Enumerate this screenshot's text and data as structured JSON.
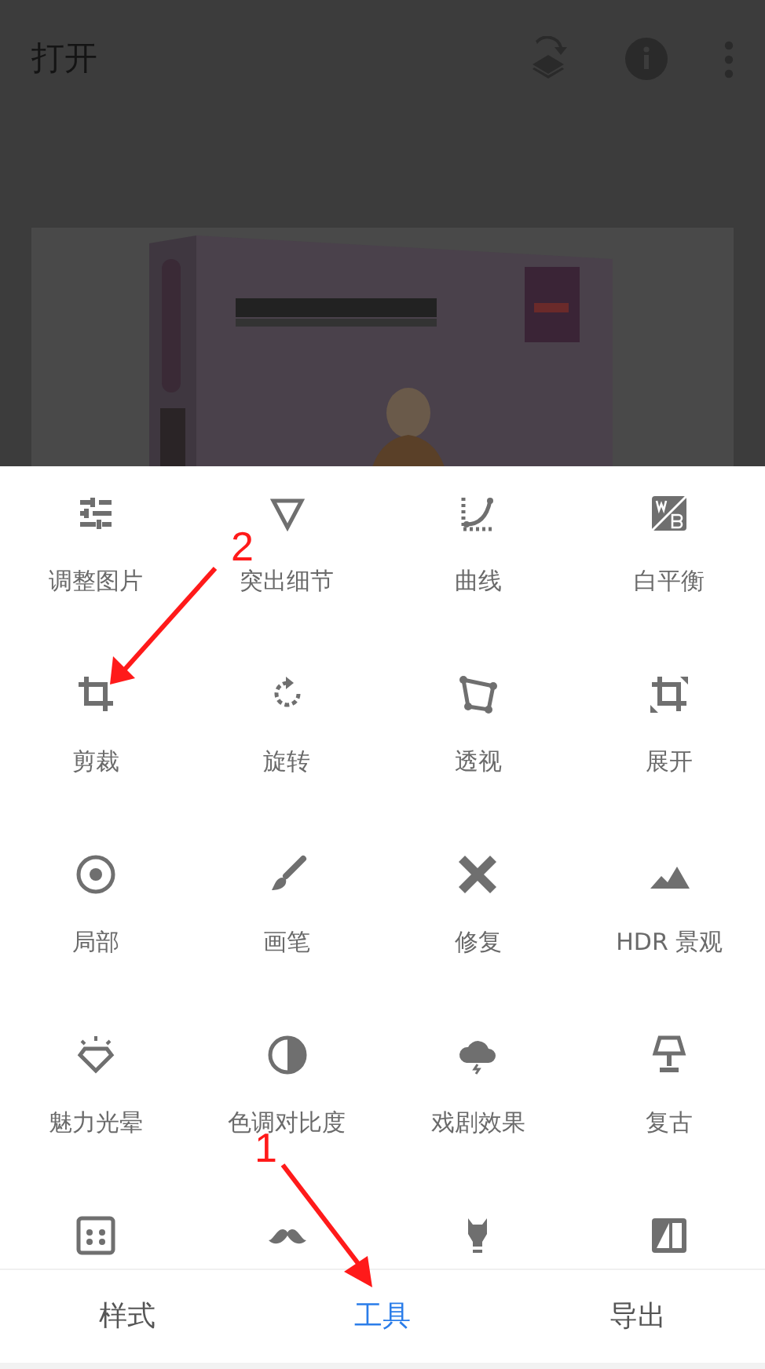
{
  "app_bar": {
    "title": "打开"
  },
  "tools": [
    {
      "kind": "tool",
      "label": "调整图片"
    },
    {
      "kind": "tool",
      "label": "突出细节"
    },
    {
      "kind": "tool",
      "label": "曲线"
    },
    {
      "kind": "tool",
      "label": "白平衡"
    },
    {
      "kind": "tool",
      "label": "剪裁"
    },
    {
      "kind": "tool",
      "label": "旋转"
    },
    {
      "kind": "tool",
      "label": "透视"
    },
    {
      "kind": "tool",
      "label": "展开"
    },
    {
      "kind": "tool",
      "label": "局部"
    },
    {
      "kind": "tool",
      "label": "画笔"
    },
    {
      "kind": "tool",
      "label": "修复"
    },
    {
      "kind": "tool",
      "label": "HDR 景观"
    },
    {
      "kind": "tool",
      "label": "魅力光晕"
    },
    {
      "kind": "tool",
      "label": "色调对比度"
    },
    {
      "kind": "tool",
      "label": "戏剧效果"
    },
    {
      "kind": "tool",
      "label": "复古"
    },
    {
      "kind": "icon_only"
    },
    {
      "kind": "icon_only"
    },
    {
      "kind": "icon_only"
    },
    {
      "kind": "icon_only"
    }
  ],
  "tabs": [
    {
      "label": "样式",
      "selected": false
    },
    {
      "label": "工具",
      "selected": true
    },
    {
      "label": "导出",
      "selected": false
    }
  ],
  "annotations": [
    {
      "label": "2"
    },
    {
      "label": "1"
    }
  ]
}
